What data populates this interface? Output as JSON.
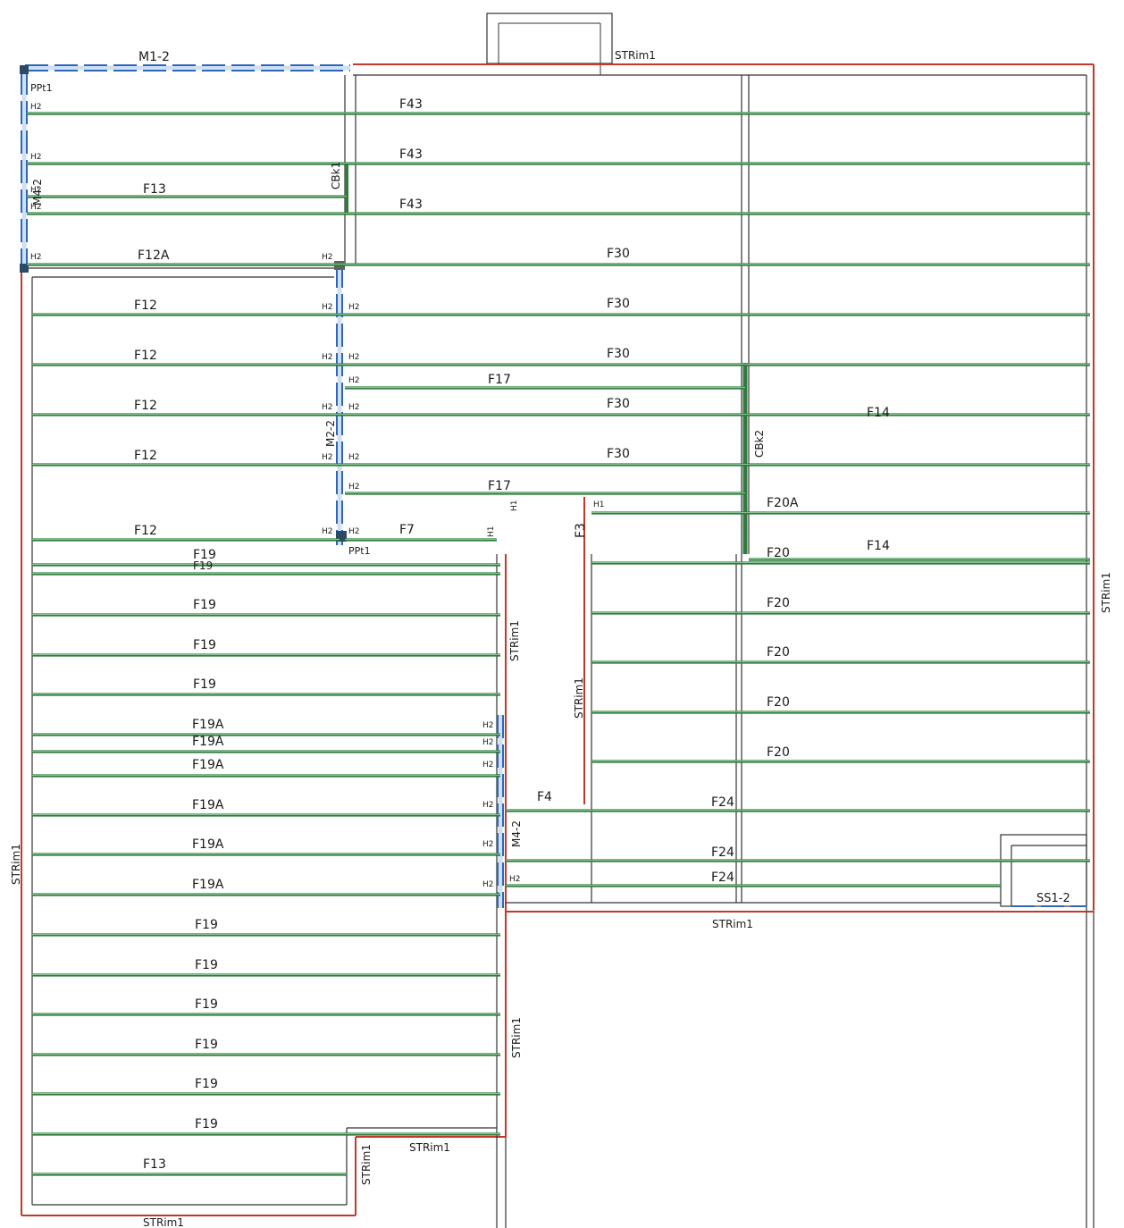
{
  "colors": {
    "joist": "#2f7d3c",
    "rim": "#c0392b",
    "beam": "#2d67b5",
    "outline": "#333333"
  },
  "labels": {
    "m1_2": "M1-2",
    "ppt1_top": "PPt1",
    "ppt1_mid": "PPt1",
    "m4_2_left": "M4-2",
    "m2_2": "M2-2",
    "m4_2_mid": "M4-2",
    "cbk1": "CBk1",
    "cbk2": "CBk2",
    "ss1_2": "SS1-2",
    "strim_top": "STRim1",
    "strim_right": "STRim1",
    "strim_left": "STRim1",
    "strim_corr_left": "STRim1",
    "strim_corr_right": "STRim1",
    "strim_mid_bottom": "STRim1",
    "strim_lower_vert": "STRim1",
    "strim_notch_h": "STRim1",
    "strim_notch_v": "STRim1",
    "strim_bottom": "STRim1",
    "f43_a": "F43",
    "f43_b": "F43",
    "f43_c": "F43",
    "f13_top": "F13",
    "f12a": "F12A",
    "f30_a": "F30",
    "f30_b": "F30",
    "f30_c": "F30",
    "f30_d": "F30",
    "f30_e": "F30",
    "f12_a": "F12",
    "f12_b": "F12",
    "f12_c": "F12",
    "f12_d": "F12",
    "f12_e": "F12",
    "f17_a": "F17",
    "f17_b": "F17",
    "f14_a": "F14",
    "f14_b": "F14",
    "f20a": "F20A",
    "f20_a": "F20",
    "f20_b": "F20",
    "f20_c": "F20",
    "f20_d": "F20",
    "f20_e": "F20",
    "f7": "F7",
    "f3": "F3",
    "f4": "F4",
    "f19_a": "F19",
    "f19_a2": "F19",
    "f19_b": "F19",
    "f19_c": "F19",
    "f19_d": "F19",
    "f19a_a": "F19A",
    "f19a_b": "F19A",
    "f19a_c": "F19A",
    "f19a_d": "F19A",
    "f19a_e": "F19A",
    "f19a_f": "F19A",
    "f24_a": "F24",
    "f24_b": "F24",
    "f24_c": "F24",
    "f19_e": "F19",
    "f19_f": "F19",
    "f19_g": "F19",
    "f19_h": "F19",
    "f19_i": "F19",
    "f19_j": "F19",
    "f13_bottom": "F13",
    "hanger_h1": "H1",
    "hanger_h2": "H2"
  }
}
